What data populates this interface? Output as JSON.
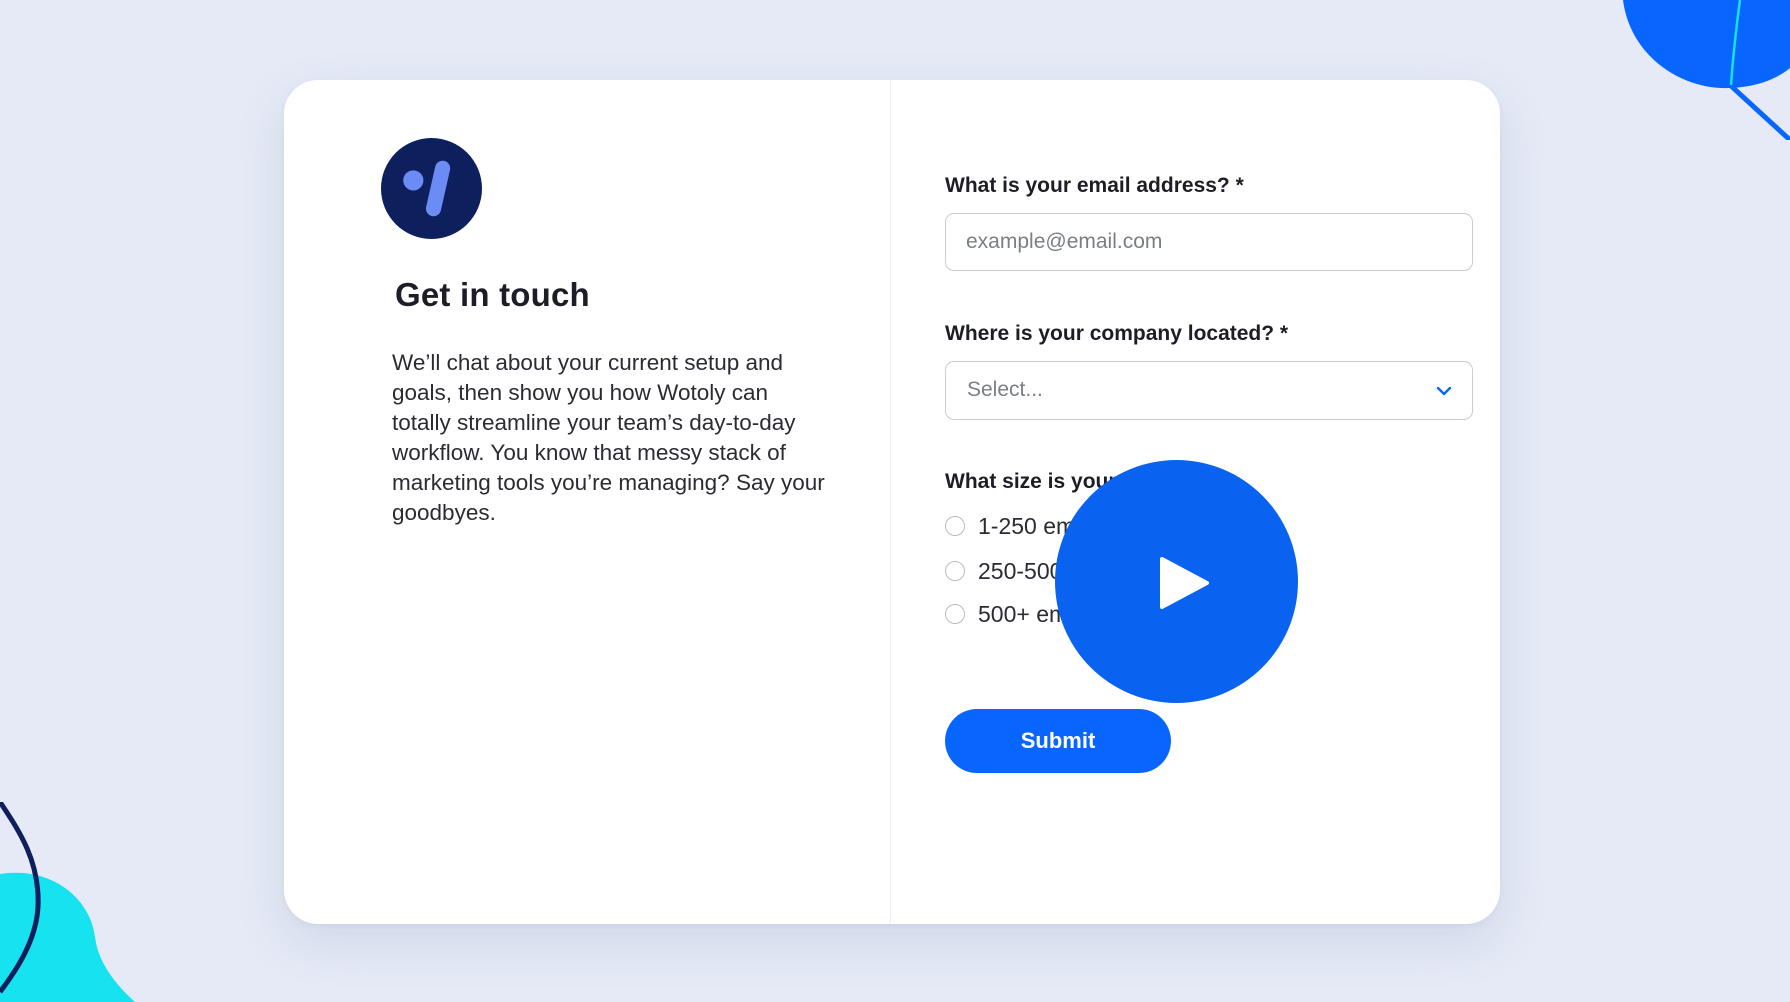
{
  "theme": {
    "accent": "#0866ff",
    "background": "#e5eaf6",
    "logo_bg": "#0d1f5c",
    "logo_mark": "#6b8cf5",
    "deco_blue": "#0866ff",
    "deco_cyan": "#17e2f0"
  },
  "left": {
    "logo_icon": "brand-logo-icon",
    "title": "Get in touch",
    "description": "We’ll chat about your current setup and goals, then show you how Wotoly can totally streamline your team’s day-to-day workflow. You know that messy stack of marketing tools you’re managing? Say your goodbyes."
  },
  "form": {
    "email": {
      "label": "What is your email address? *",
      "placeholder": "example@email.com",
      "value": ""
    },
    "location": {
      "label": "Where is your company located? *",
      "selected": "Select...",
      "icon": "chevron-down-icon"
    },
    "size": {
      "label": "What size is your company?",
      "options": [
        {
          "label": "1-250 employees",
          "selected": false
        },
        {
          "label": "250-500 employees",
          "selected": false
        },
        {
          "label": "500+ employees",
          "selected": false
        }
      ]
    },
    "submit_label": "Submit"
  },
  "overlay": {
    "play_icon": "play-icon"
  }
}
